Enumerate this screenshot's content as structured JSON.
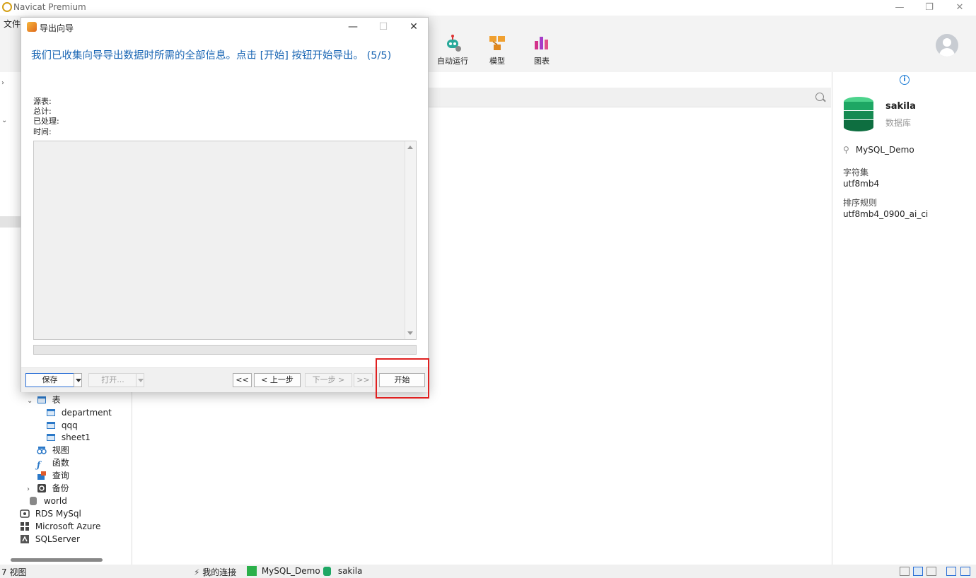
{
  "app": {
    "title": "Navicat Premium"
  },
  "window_controls": {
    "minimize": "—",
    "restore": "❐",
    "close": "✕"
  },
  "menu": {
    "file": "文件"
  },
  "toolbar": {
    "automation": "自动运行",
    "model": "模型",
    "chart": "图表"
  },
  "tree": {
    "tables_group": "表",
    "tables": [
      "department",
      "qqq",
      "sheet1"
    ],
    "views": "视图",
    "functions": "函数",
    "queries": "查询",
    "backups": "备份",
    "world": "world",
    "rds": "RDS MySql",
    "azure": "Microsoft Azure",
    "sqlserver": "SQLServer"
  },
  "info_panel": {
    "db_name": "sakila",
    "db_type": "数据库",
    "connection": "MySQL_Demo",
    "charset_label": "字符集",
    "charset_value": "utf8mb4",
    "collation_label": "排序规则",
    "collation_value": "utf8mb4_0900_ai_ci"
  },
  "statusbar": {
    "view_count": "7 视图",
    "my_connections": "我的连接",
    "connection": "MySQL_Demo",
    "database": "sakila"
  },
  "dialog": {
    "title": "导出向导",
    "heading": "我们已收集向导导出数据时所需的全部信息。点击 [开始] 按钮开始导出。 (5/5)",
    "source_label": "源表:",
    "total_label": "总计:",
    "processed_label": "已处理:",
    "time_label": "时间:",
    "buttons": {
      "save": "保存",
      "open": "打开...",
      "first": "<<",
      "prev": "< 上一步",
      "next": "下一步 >",
      "last": ">>",
      "start": "开始"
    },
    "controls": {
      "minimize": "—",
      "maximize": "☐",
      "close": "✕"
    }
  },
  "colors": {
    "heading_blue": "#1a66b4",
    "db_green": "#1e9e5e",
    "highlight_red": "#e02020"
  }
}
